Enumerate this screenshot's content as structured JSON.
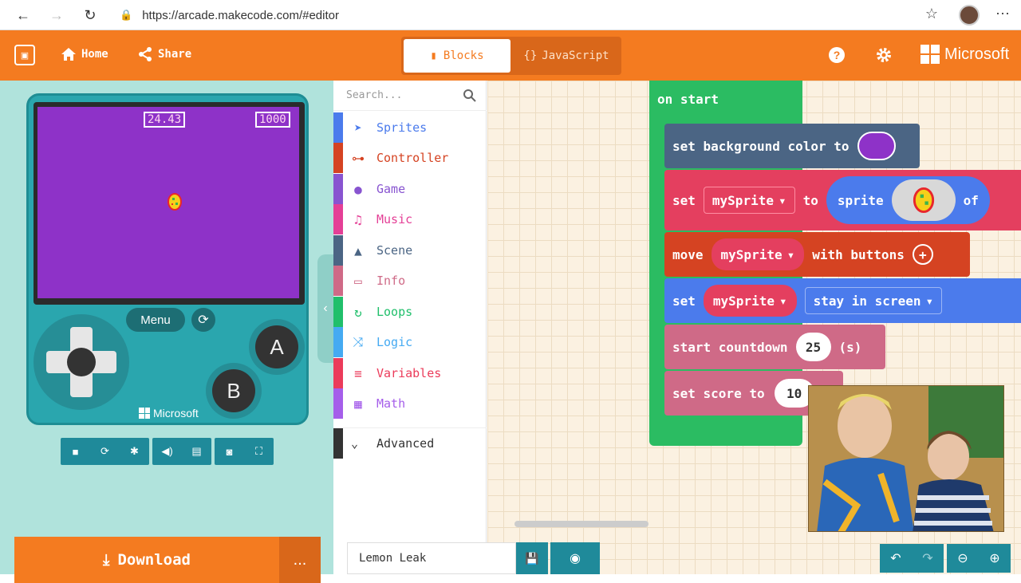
{
  "browser": {
    "url": "https://arcade.makecode.com/#editor"
  },
  "header": {
    "home_label": "Home",
    "share_label": "Share",
    "blocks_label": "Blocks",
    "javascript_label": "JavaScript",
    "brand_label": "Microsoft"
  },
  "simulator": {
    "timer": "24.43",
    "score": "1000",
    "menu_label": "Menu",
    "button_a": "A",
    "button_b": "B",
    "brand_label": "Microsoft",
    "download_label": "Download",
    "more_label": "..."
  },
  "toolbox": {
    "search_placeholder": "Search...",
    "categories": [
      {
        "label": "Sprites",
        "color": "#4b7bec",
        "icon": "paper-plane-icon"
      },
      {
        "label": "Controller",
        "color": "#d54322",
        "icon": "gamepad-icon"
      },
      {
        "label": "Game",
        "color": "#8854d0",
        "icon": "circle-icon"
      },
      {
        "label": "Music",
        "color": "#e43f96",
        "icon": "headphones-icon"
      },
      {
        "label": "Scene",
        "color": "#4b6584",
        "icon": "tree-icon"
      },
      {
        "label": "Info",
        "color": "#cf6a87",
        "icon": "id-card-icon"
      },
      {
        "label": "Loops",
        "color": "#20bf6b",
        "icon": "loop-icon"
      },
      {
        "label": "Logic",
        "color": "#45aaf2",
        "icon": "shuffle-icon"
      },
      {
        "label": "Variables",
        "color": "#eb3b5a",
        "icon": "list-icon"
      },
      {
        "label": "Math",
        "color": "#a55eea",
        "icon": "calculator-icon"
      }
    ],
    "advanced_label": "Advanced"
  },
  "blocks": {
    "on_start": "on start",
    "set_bg": "set background color to",
    "bg_color": "#8e32c8",
    "set": "set",
    "to": "to",
    "sprite_var": "mySprite",
    "sprite_kw": "sprite",
    "of_kw": "of",
    "move": "move",
    "with_buttons": "with buttons",
    "stay_in_screen": "stay in screen",
    "start_countdown": "start countdown",
    "countdown_value": "25",
    "seconds_unit": "(s)",
    "set_score": "set score to",
    "score_value": "10"
  },
  "bottom_bar": {
    "project_name": "Lemon Leak"
  },
  "colors": {
    "accent": "#f47b20",
    "sim_bg": "#b0e3dc",
    "loops": "#20bf6b",
    "scene": "#4b6584",
    "sprites_block": "#e43f5f",
    "controller_block": "#d54322",
    "info_block": "#cf6a87"
  }
}
